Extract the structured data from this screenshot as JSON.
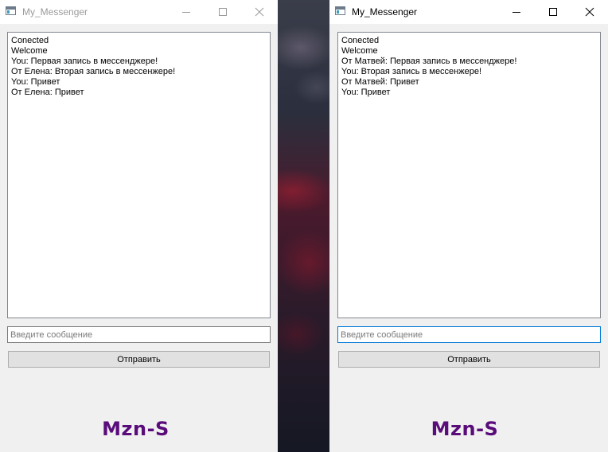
{
  "watermark_color": "#5a0c7a",
  "windows": [
    {
      "id": "left",
      "title": "My_Messenger",
      "active": false,
      "chat_lines": [
        "Conected",
        "Welcome",
        "You: Первая запись в мессенджере!",
        "От Елена: Вторая запись в мессенжере!",
        "You: Привет",
        "От Елена: Привет"
      ],
      "input": {
        "value": "",
        "placeholder": "Введите сообщение"
      },
      "send_label": "Отправить",
      "watermark": "Mzn-S"
    },
    {
      "id": "right",
      "title": "My_Messenger",
      "active": true,
      "chat_lines": [
        "Conected",
        "Welcome",
        "От Матвей: Первая запись в мессенджере!",
        "You: Вторая запись в мессенжере!",
        "От Матвей: Привет",
        "You: Привет"
      ],
      "input": {
        "value": "",
        "placeholder": "Введите сообщение"
      },
      "send_label": "Отправить",
      "watermark": "Mzn-S"
    }
  ]
}
